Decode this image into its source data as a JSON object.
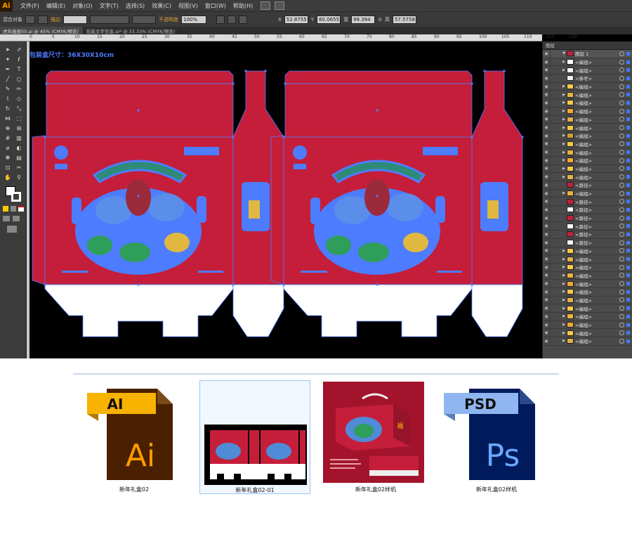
{
  "app": {
    "logo": "Ai",
    "menus": [
      "文件(F)",
      "编辑(E)",
      "对象(O)",
      "文字(T)",
      "选择(S)",
      "效果(C)",
      "视图(V)",
      "窗口(W)",
      "帮助(H)"
    ]
  },
  "controlbar": {
    "blend_label": "混合对象",
    "stroke_label": "描边",
    "opacity_label": "不透明度",
    "opacity_value": "100%",
    "x_label": "X",
    "x_value": "52.8755",
    "y_label": "Y",
    "y_value": "60.0655",
    "w_label": "宽",
    "w_value": "99.394",
    "h_label": "高",
    "h_value": "57.5758"
  },
  "doctabs": [
    "虎年画画50.ai @ 45% (CMYK/预览)",
    "包装文字信息.ai* @ 33.33% (CMYK/预览)"
  ],
  "ruler_numbers": [
    "0",
    "5",
    "10",
    "15",
    "20",
    "25",
    "30",
    "35",
    "40",
    "45",
    "50",
    "55",
    "60",
    "65",
    "70",
    "75",
    "80",
    "85",
    "90",
    "95",
    "100",
    "105",
    "110",
    "115",
    "120"
  ],
  "canvas": {
    "size_label": "包装盒尺寸：36X30X10cm",
    "box_color": "#c41e3a",
    "guide_color": "#4d7cff"
  },
  "layers": {
    "panel_title": "图层",
    "top_layer": "图层 1",
    "rows": [
      "<编组>",
      "<编组>",
      "<参考>",
      "<编组>",
      "<编组>",
      "<编组>",
      "<编组>",
      "<编组>",
      "<编组>",
      "<编组>",
      "<编组>",
      "<编组>",
      "<编组>",
      "<编组>",
      "<编组>",
      "<路径>",
      "<编组>",
      "<路径>",
      "<路径>",
      "<路径>",
      "<路径>",
      "<路径>",
      "<路径>",
      "<编组>",
      "<编组>",
      "<编组>",
      "<编组>",
      "<编组>",
      "<编组>",
      "<编组>",
      "<编组>",
      "<编组>",
      "<编组>",
      "<编组>",
      "<编组>"
    ]
  },
  "explorer": {
    "files": [
      {
        "name": "新年礼盒02",
        "tag": "AI",
        "letters": "Ai",
        "tag_color": "#f7b300",
        "body_color": "#4a2000",
        "letter_color": "#ff9a00"
      },
      {
        "name": "新年礼盒02-01",
        "kind": "thumbnail"
      },
      {
        "name": "新年礼盒02样机",
        "kind": "mockup"
      },
      {
        "name": "新年礼盒02样机",
        "tag": "PSD",
        "letters": "Ps",
        "tag_color": "#8fb6f0",
        "body_color": "#001a5c",
        "letter_color": "#6aa9ff"
      }
    ]
  }
}
